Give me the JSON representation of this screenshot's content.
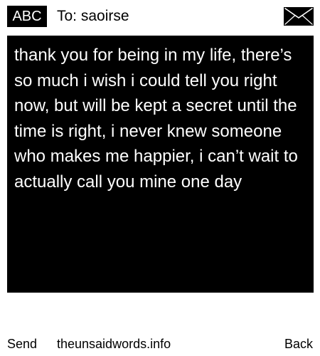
{
  "header": {
    "mode_label": "ABC",
    "to_prefix": "To:",
    "recipient": "saoirse",
    "envelope_icon": "envelope-icon"
  },
  "message": {
    "body": "thank you for being in my life, there’s so much i wish i could tell you right now, but will be kept a secret until the time is right, i never knew someone who makes me happier, i can’t wait to actually call you mine one day"
  },
  "footer": {
    "send_label": "Send",
    "site_label": "theunsaidwords.info",
    "back_label": "Back"
  },
  "colors": {
    "background": "#ffffff",
    "message_box": "#000000",
    "message_text": "#ffffff",
    "badge_bg": "#000000",
    "badge_text": "#ffffff"
  }
}
